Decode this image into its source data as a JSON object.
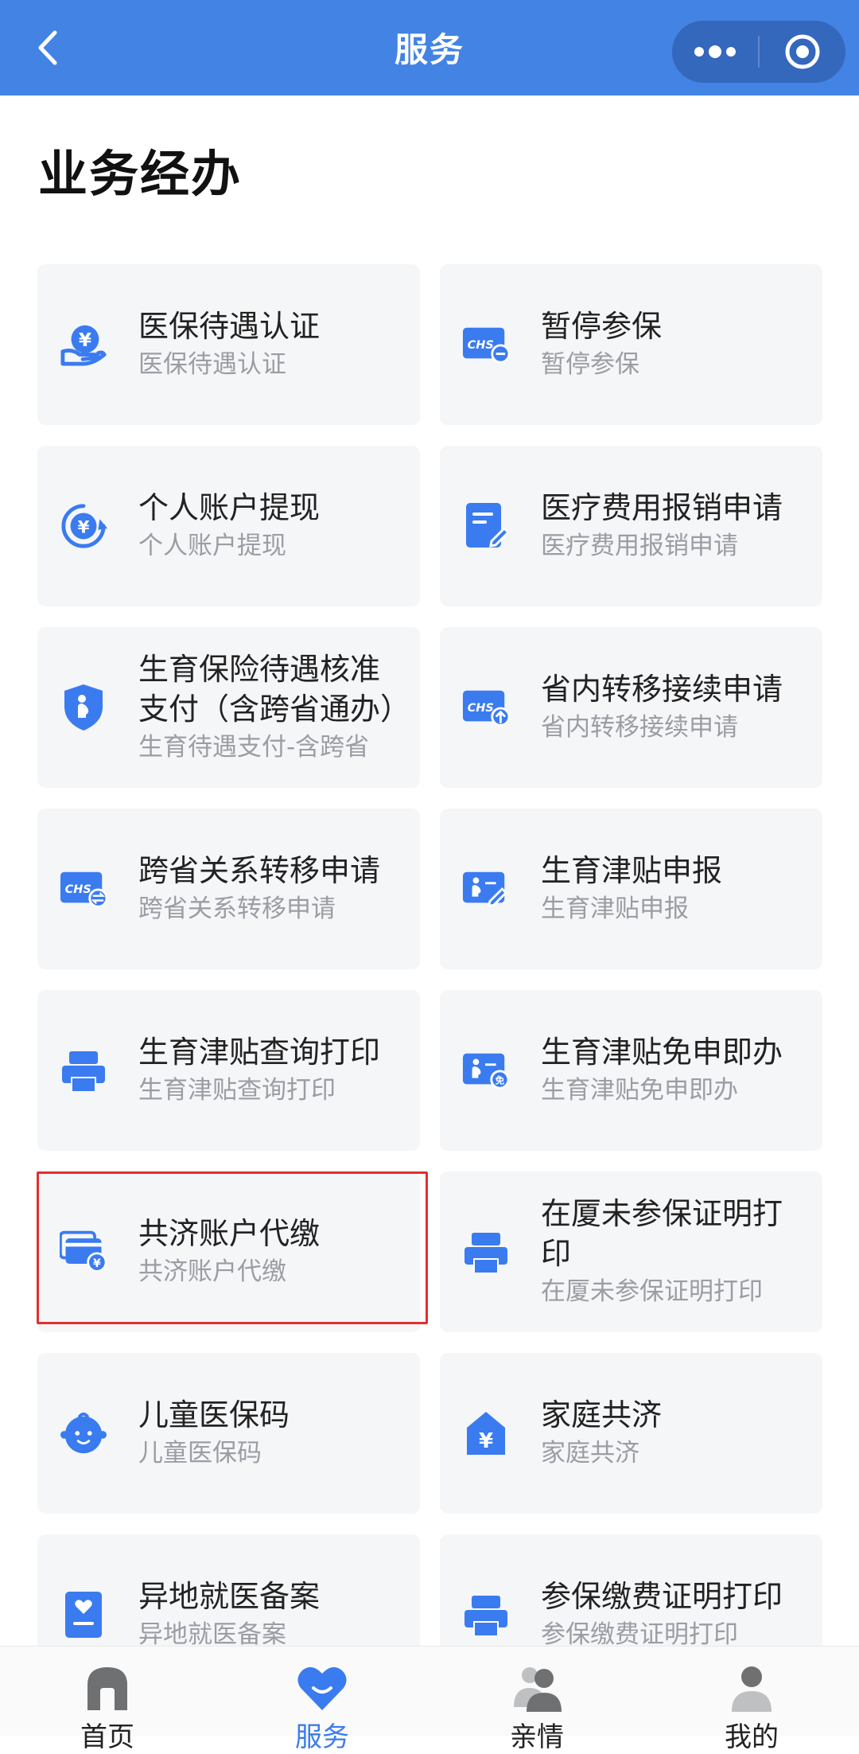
{
  "header": {
    "title": "服务",
    "more_icon": "more-dots-icon",
    "close_icon": "record-circle-icon",
    "back_icon": "chevron-left-icon"
  },
  "section": {
    "title": "业务经办"
  },
  "cards": [
    {
      "title": "医保待遇认证",
      "subtitle": "医保待遇认证",
      "icon": "hand-yuan-icon"
    },
    {
      "title": "暂停参保",
      "subtitle": "暂停参保",
      "icon": "chs-card-minus-icon"
    },
    {
      "title": "个人账户提现",
      "subtitle": "个人账户提现",
      "icon": "yuan-refresh-icon"
    },
    {
      "title": "医疗费用报销申请",
      "subtitle": "医疗费用报销申请",
      "icon": "document-edit-icon"
    },
    {
      "title": "生育保险待遇核准支付（含跨省通办）",
      "subtitle": "生育待遇支付-含跨省",
      "icon": "shield-mother-icon"
    },
    {
      "title": "省内转移接续申请",
      "subtitle": "省内转移接续申请",
      "icon": "chs-card-upload-icon"
    },
    {
      "title": "跨省关系转移申请",
      "subtitle": "跨省关系转移申请",
      "icon": "chs-card-transfer-icon"
    },
    {
      "title": "生育津贴申报",
      "subtitle": "生育津贴申报",
      "icon": "mother-card-edit-icon"
    },
    {
      "title": "生育津贴查询打印",
      "subtitle": "生育津贴查询打印",
      "icon": "printer-icon"
    },
    {
      "title": "生育津贴免申即办",
      "subtitle": "生育津贴免申即办",
      "icon": "mother-card-free-icon"
    },
    {
      "title": "共济账户代缴",
      "subtitle": "共济账户代缴",
      "icon": "card-yuan-icon"
    },
    {
      "title": "在厦未参保证明打印",
      "subtitle": "在厦未参保证明打印",
      "icon": "printer-icon"
    },
    {
      "title": "儿童医保码",
      "subtitle": "儿童医保码",
      "icon": "baby-face-icon"
    },
    {
      "title": "家庭共济",
      "subtitle": "家庭共济",
      "icon": "house-yuan-icon"
    },
    {
      "title": "异地就医备案",
      "subtitle": "异地就医备案",
      "icon": "heart-document-icon"
    },
    {
      "title": "参保缴费证明打印",
      "subtitle": "参保缴费证明打印",
      "icon": "printer-icon"
    }
  ],
  "tabbar": [
    {
      "label": "首页",
      "icon": "home-icon",
      "active": false
    },
    {
      "label": "服务",
      "icon": "heart-service-icon",
      "active": true
    },
    {
      "label": "亲情",
      "icon": "family-icon",
      "active": false
    },
    {
      "label": "我的",
      "icon": "user-icon",
      "active": false
    }
  ],
  "colors": {
    "primary": "#4283e4",
    "icon_blue": "#3a7bf0",
    "highlight": "#e0302f"
  }
}
